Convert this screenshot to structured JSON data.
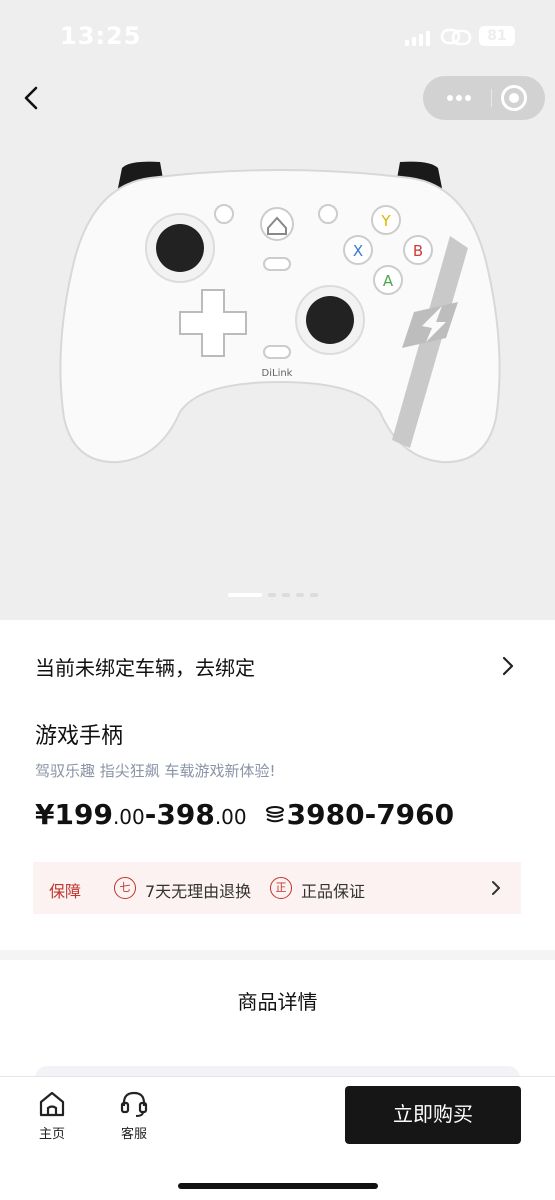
{
  "status_bar": {
    "time": "13:25",
    "battery": "81"
  },
  "product": {
    "bind_prompt": "当前未绑定车辆，去绑定",
    "title": "游戏手柄",
    "subtitle": "驾驭乐趣 指尖狂飙 车载游戏新体验!",
    "price": {
      "currency": "¥",
      "low_int": "199",
      "low_dec": ".00",
      "separator": "-",
      "high_int": "398",
      "high_dec": ".00",
      "points": "3980-7960"
    },
    "controller_brand": "DiLink",
    "controller_buttons": {
      "y": "Y",
      "x": "X",
      "b": "B",
      "a": "A"
    },
    "gallery": {
      "total_images": 5,
      "active_index": 0
    }
  },
  "guarantee": {
    "label": "保障",
    "items": [
      {
        "badge": "七",
        "text": "7天无理由退换"
      },
      {
        "badge": "正",
        "text": "正品保证"
      }
    ]
  },
  "details": {
    "title": "商品详情"
  },
  "bottom_bar": {
    "tabs": [
      {
        "label": "主页",
        "icon": "home-icon"
      },
      {
        "label": "客服",
        "icon": "headset-icon"
      }
    ],
    "buy_label": "立即购买"
  },
  "colors": {
    "accent_red": "#c0362c",
    "guarantee_bg": "#fdf2f2",
    "buy_button_bg": "#161616",
    "subtitle_gray": "#8a94a6",
    "hero_bg": "#eeeeee"
  }
}
